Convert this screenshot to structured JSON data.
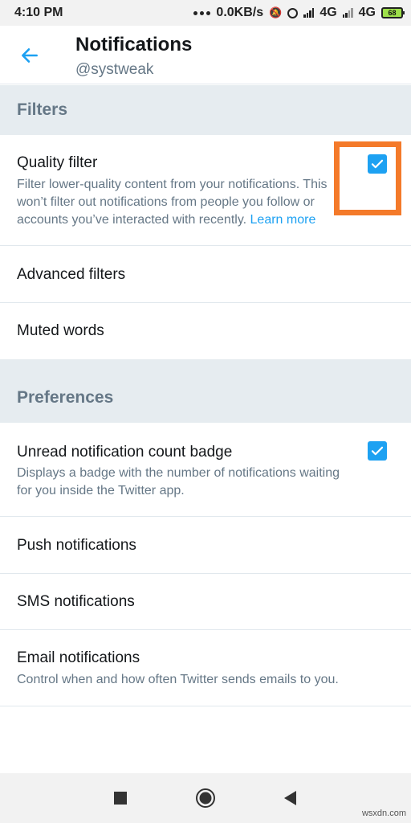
{
  "status_bar": {
    "time": "4:10 PM",
    "speed": "0.0KB/s",
    "network1": "4G",
    "network2": "4G",
    "battery": "68"
  },
  "header": {
    "title": "Notifications",
    "username": "@systweak",
    "back_icon": "arrow-left-icon"
  },
  "sections": {
    "filters": {
      "title": "Filters",
      "quality_filter": {
        "label": "Quality filter",
        "desc_line1": "Filter lower-quality content from your notifications. This",
        "desc_line2": "won’t filter out notifications from people you follow or",
        "desc_line3": "accounts you’ve interacted with recently.",
        "learn_more": "Learn more",
        "checked": true
      },
      "advanced_filters": "Advanced filters",
      "muted_words": "Muted words"
    },
    "preferences": {
      "title": "Preferences",
      "unread_badge": {
        "label": "Unread notification count badge",
        "desc_line1": "Displays a badge with the number of notifications waiting",
        "desc_line2": "for you inside the Twitter app.",
        "checked": true
      },
      "push": "Push notifications",
      "sms": "SMS notifications",
      "email": {
        "label": "Email notifications",
        "desc": "Control when and how often Twitter sends emails to you."
      }
    }
  },
  "nav_bar": {
    "recent_icon": "square-icon",
    "home_icon": "circle-icon",
    "back_icon": "triangle-back-icon"
  },
  "watermark": "wsxdn.com",
  "colors": {
    "accent": "#1da1f2",
    "highlight": "#f47a2a",
    "section_bg": "#e6ecf0",
    "secondary_text": "#657786"
  }
}
